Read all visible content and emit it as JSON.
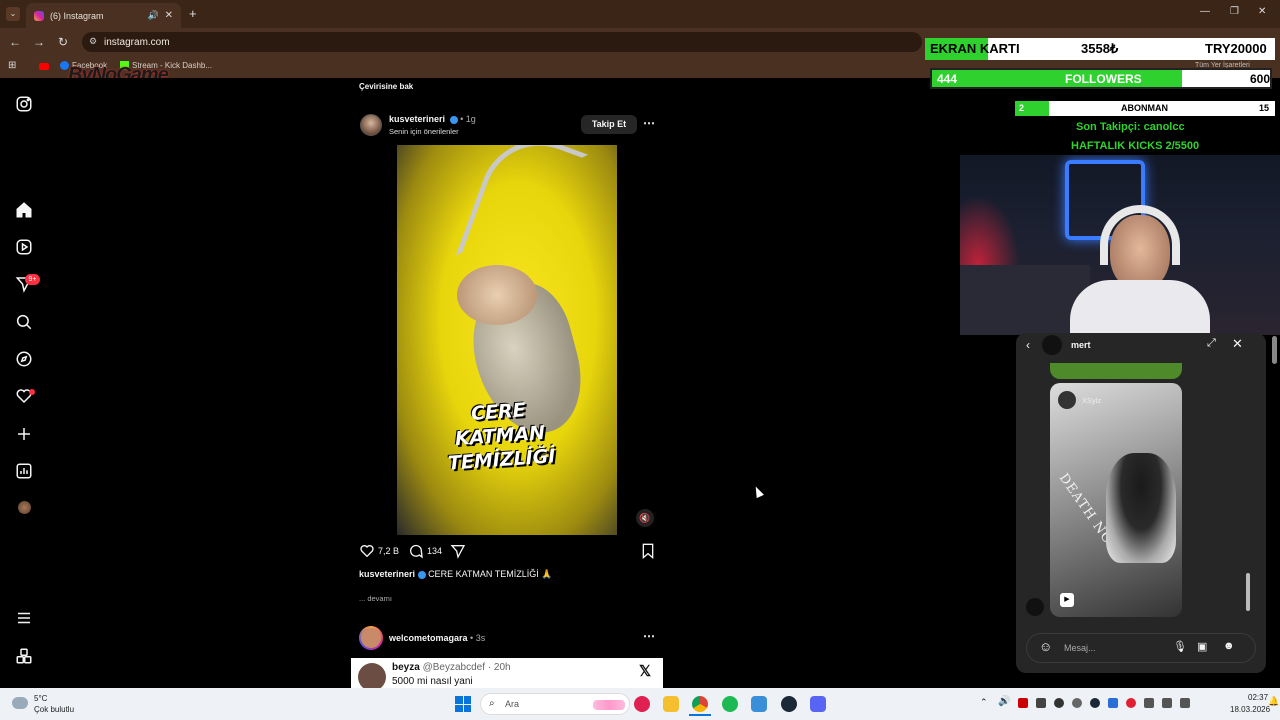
{
  "browser": {
    "tab_title": "(6) Instagram",
    "url": "instagram.com",
    "bookmarks": [
      "Facebook",
      "Stream - Kick Dashb..."
    ],
    "bookmarks_right": "Tüm Yer İşaretleri",
    "watermark": "ByNoGame"
  },
  "feed": {
    "prev_caption_link": "Çevirisine bak",
    "post": {
      "username": "kusveterineri",
      "time": "1g",
      "subtitle": "Senin için önerilenler",
      "follow_label": "Takip Et",
      "overlay_text": "CERE KATMAN TEMİZLİĞİ",
      "likes": "7,2 B",
      "comments": "134",
      "caption_user": "kusveterineri",
      "caption_text": "CERE KATMAN TEMİZLİĞİ 🙏",
      "more_label": "... devamı"
    },
    "next_post": {
      "username": "welcometomagara",
      "time": "3s"
    },
    "embedded_tweet": {
      "name": "beyza",
      "handle": "@Beyzabcdef",
      "time": "20h",
      "text": "5000 mi nasıl yani"
    }
  },
  "sidebar": {
    "notification_badge": "9+"
  },
  "stream_overlay": {
    "ekran_label": "EKRAN KARTI",
    "ekran_amount": "3558₺",
    "ekran_goal": "TRY20000",
    "ekran_progress": 0.18,
    "followers_current": "444",
    "followers_label": "FOLLOWERS",
    "followers_goal": "600",
    "followers_progress": 0.74,
    "abonman_current": "2",
    "abonman_label": "ABONMAN",
    "abonman_goal": "15",
    "abonman_progress": 0.13,
    "last_follower": "Son Takipçi: canolcc",
    "weekly_kicks": "HAFTALIK KICKS 2/5500"
  },
  "dm_panel": {
    "contact": "mert",
    "shared_post_user": "XSylz",
    "shared_image_text": "DEATH NOTE",
    "message_placeholder": "Mesaj..."
  },
  "taskbar": {
    "weather_temp": "5°C",
    "weather_desc": "Çok bulutlu",
    "search_label": "Ara",
    "time": "02:37",
    "date": "18.03.2026"
  },
  "colors": {
    "overlay_green": "#2fd12f",
    "ig_blue_badge": "#3897f0",
    "notification_red": "#ff3040"
  }
}
